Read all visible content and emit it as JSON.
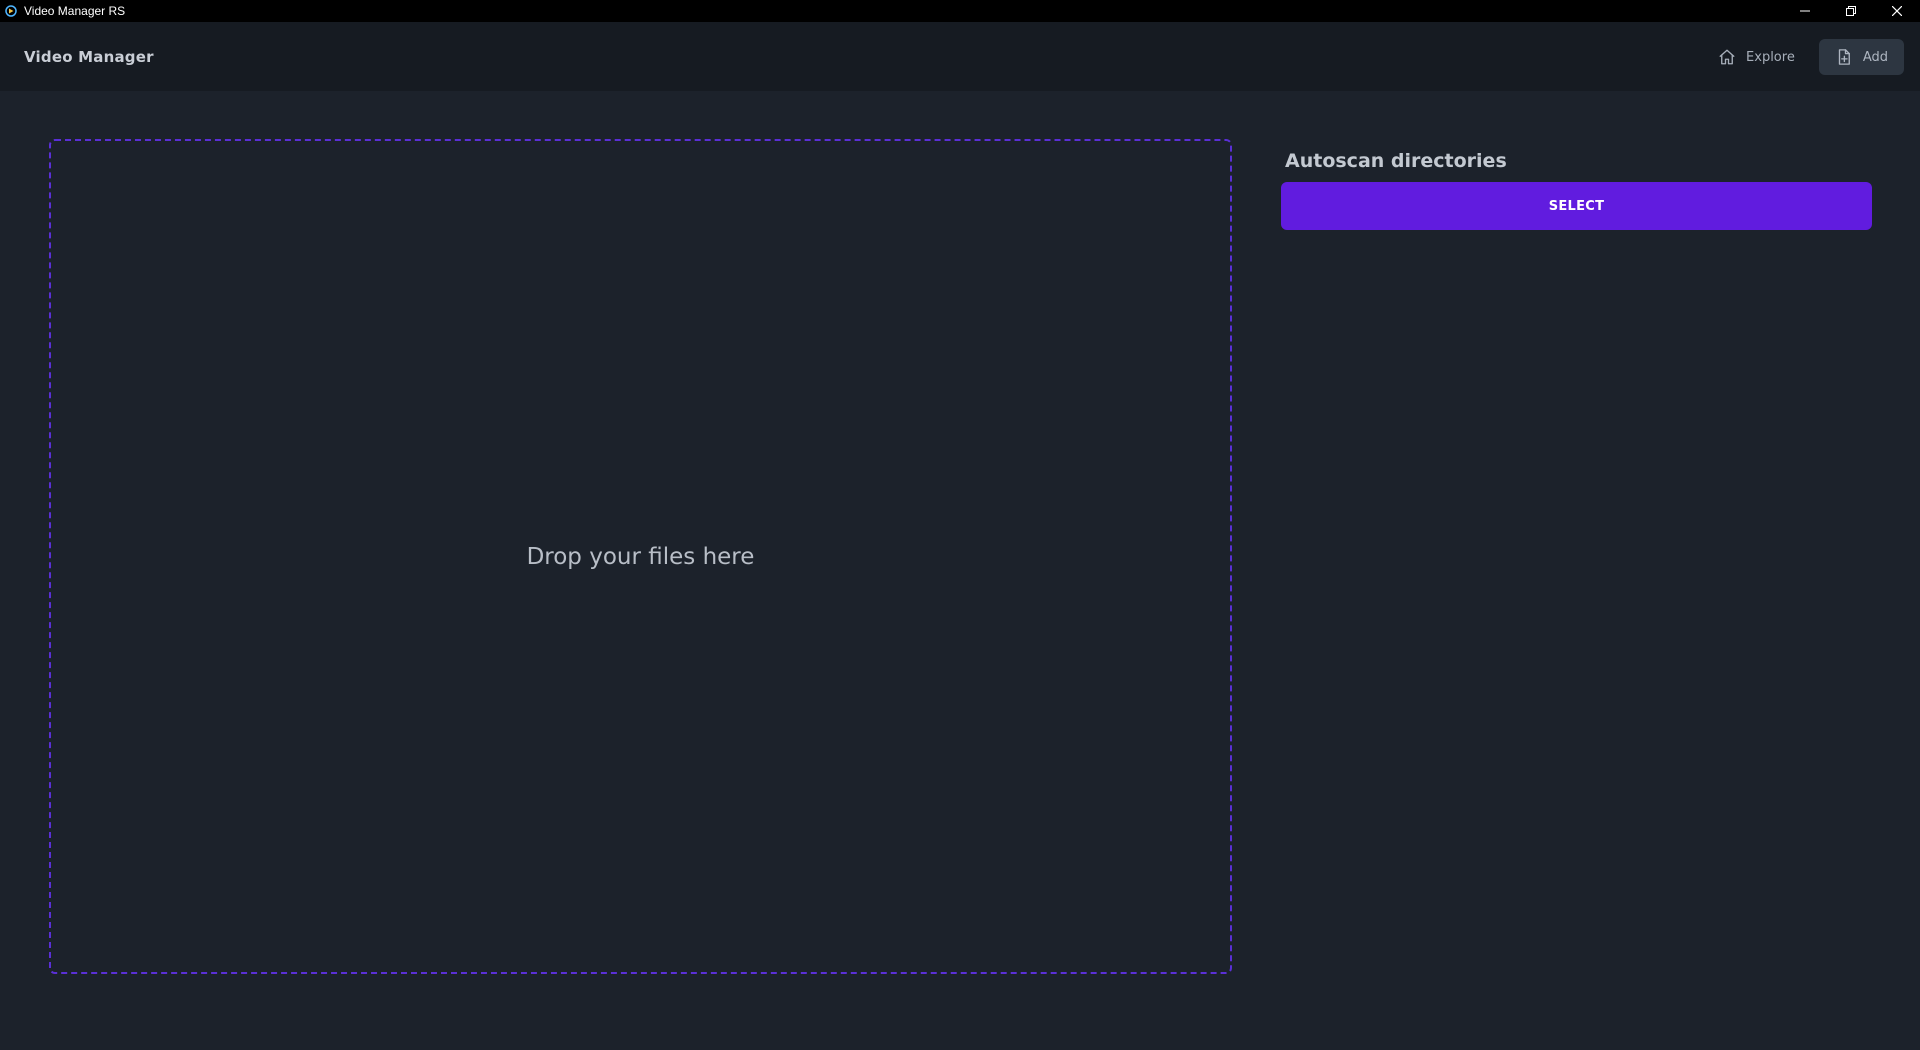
{
  "window": {
    "title": "Video Manager RS",
    "controls": {
      "minimize_icon": "minimize-icon",
      "restore_icon": "restore-icon",
      "close_icon": "close-icon"
    }
  },
  "header": {
    "brand": "Video Manager",
    "nav": [
      {
        "label": "Explore",
        "icon": "home-icon",
        "active": false
      },
      {
        "label": "Add",
        "icon": "file-add-icon",
        "active": true
      }
    ]
  },
  "dropzone": {
    "text": "Drop your files here"
  },
  "autoscan": {
    "title": "Autoscan directories",
    "button_label": "SELECT"
  },
  "colors": {
    "background": "#1c222b",
    "header": "#161b22",
    "accent": "#611cdf",
    "dashed_border": "#5a2fd6"
  }
}
